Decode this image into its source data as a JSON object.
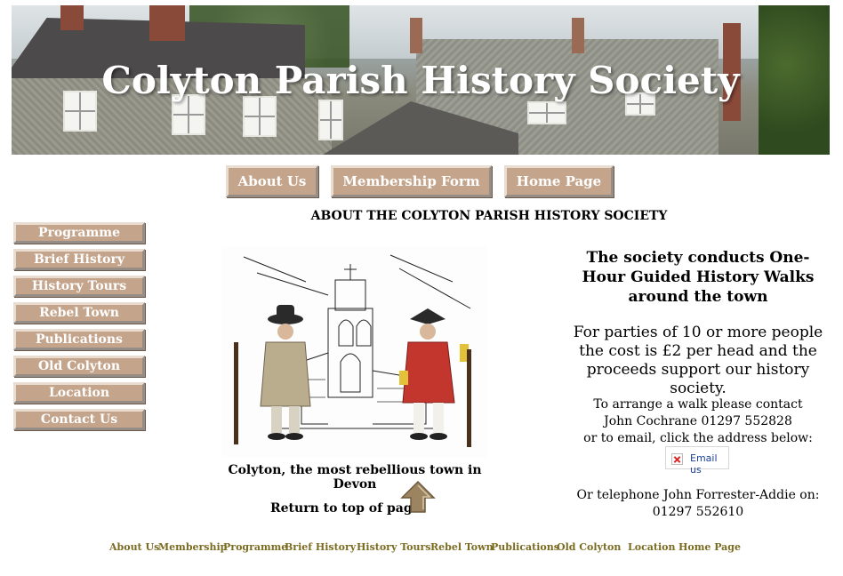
{
  "header": {
    "title": "Colyton Parish History Society"
  },
  "topnav": [
    {
      "label": "About Us"
    },
    {
      "label": "Membership Form"
    },
    {
      "label": "Home Page"
    }
  ],
  "sidebar": [
    {
      "label": "Programme"
    },
    {
      "label": "Brief History"
    },
    {
      "label": "History Tours"
    },
    {
      "label": "Rebel Town"
    },
    {
      "label": "Publications"
    },
    {
      "label": "Old Colyton"
    },
    {
      "label": "Location"
    },
    {
      "label": "Contact Us"
    }
  ],
  "main": {
    "heading": "ABOUT THE COLYTON PARISH HISTORY SOCIETY",
    "caption": "Colyton, the most rebellious town in Devon",
    "return_label": "Return to top of page"
  },
  "right": {
    "headline": "The society conducts One-Hour Guided History Walks around the town",
    "cost": "For parties of 10 or more people the cost is £2 per head and the proceeds support our history society.",
    "arrange_line1": "To arrange a walk please contact",
    "arrange_line2": "John Cochrane 01297 552828",
    "arrange_line3": "or to email, click the address below:",
    "email_label": "Email us",
    "phone_line1": "Or telephone John Forrester-Addie on:",
    "phone_line2": "01297 552610"
  },
  "footer": [
    {
      "label": "About Us"
    },
    {
      "label": "Membership"
    },
    {
      "label": "Programme"
    },
    {
      "label": "Brief History"
    },
    {
      "label": "History Tours"
    },
    {
      "label": "Rebel Town"
    },
    {
      "label": "Publications"
    },
    {
      "label": "Old Colyton"
    },
    {
      "label": "Location"
    },
    {
      "label": "Home Page"
    }
  ],
  "colors": {
    "button": "#c4a58c",
    "footer_link": "#7a6b20"
  }
}
